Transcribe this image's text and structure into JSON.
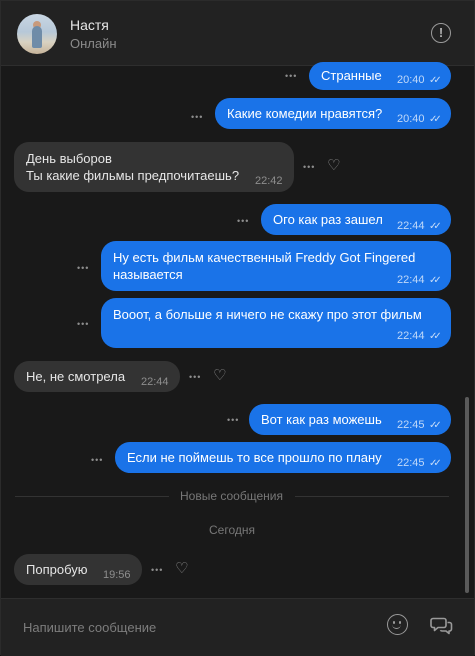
{
  "header": {
    "name": "Настя",
    "status": "Онлайн"
  },
  "messages": [
    {
      "text": "Странные",
      "time": "20:40"
    },
    {
      "text": "Какие комедии нравятся?",
      "time": "20:40"
    },
    {
      "line1": "День выборов",
      "line2": "Ты какие фильмы предпочитаешь?",
      "time": "22:42"
    },
    {
      "text": "Ого как раз зашел",
      "time": "22:44"
    },
    {
      "line1": "Ну есть фильм качественный Freddy Got Fingered",
      "line2": "называется",
      "time": "22:44"
    },
    {
      "text": "Вооот, а больше я ничего не скажу про этот фильм",
      "time": "22:44"
    },
    {
      "text": "Не, не смотрела",
      "time": "22:44"
    },
    {
      "text": "Вот как раз можешь",
      "time": "22:45"
    },
    {
      "text": "Если не поймешь то все прошло по плану",
      "time": "22:45"
    },
    {
      "text": "Попробую",
      "time": "19:56"
    }
  ],
  "separator": "Новые сообщения",
  "date": "Сегодня",
  "composer": {
    "placeholder": "Напишите сообщение"
  },
  "glyphs": {
    "more": "•••",
    "checks": "✓✓",
    "heart": "♡",
    "info": "!"
  },
  "colors": {
    "outgoing": "#1a73e8",
    "incoming": "#333333",
    "background": "#191919"
  }
}
